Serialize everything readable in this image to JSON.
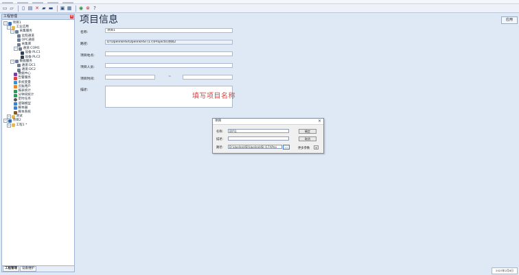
{
  "toolbar": {
    "icons": [
      "new-icon",
      "open-icon",
      "save-doc-icon",
      "print-icon",
      "delete-icon",
      "folder-open-icon",
      "folder-icon",
      "save-icon",
      "save-as-icon",
      "refresh-icon",
      "stop-icon",
      "help-icon"
    ]
  },
  "left_panel": {
    "title": "工程管理",
    "tree": [
      "项目1",
      "工业应用",
      "采集服务",
      "远程通道",
      "OPC通道",
      "采集库",
      "通道:COM1",
      "设备:PLC1",
      "设备:PLC2",
      "数据服务",
      "通道:DC1",
      "通道:DC2",
      "数据中心",
      "告警服务",
      "系统变量",
      "云账用户",
      "报表统计",
      "分钟间统计",
      "定时任务",
      "逻辑模型",
      "脚本器",
      "脚本系统",
      "测试",
      "项目2",
      "工程1 *"
    ],
    "tabs": [
      "工程管理",
      "设备维护"
    ]
  },
  "main": {
    "title": "项目信息",
    "apply_label": "应用",
    "fields": {
      "name_label": "名称:",
      "name_value": "项目1",
      "path_label": "路径:",
      "path_value": "D:\\UpelinkHSI\\UpelinkHSI (17)\\Projects\\项目2",
      "location_label": "项目地点:",
      "location_value": "",
      "person_label": "项目人员:",
      "person_value": "",
      "time_label": "项目时间:",
      "time_start": "",
      "time_sep": "~",
      "time_end": "",
      "desc_label": "描述:",
      "desc_value": ""
    },
    "annotation": "填写项目名称"
  },
  "dialog": {
    "title": "项目",
    "close_label": "×",
    "name_label": "名称:",
    "name_value": "项目1",
    "desc_label": "描述:",
    "desc_value": "",
    "path_label": "路径:",
    "path_value": "D:\\UpelinkHSI\\UpelinkHSI (17)\\Proj",
    "browse_label": "...",
    "ok_label": "确定",
    "cancel_label": "取消",
    "more_label": "更多参数",
    "more_btn_label": "+"
  },
  "status": {
    "date": "2023年2月8日"
  }
}
